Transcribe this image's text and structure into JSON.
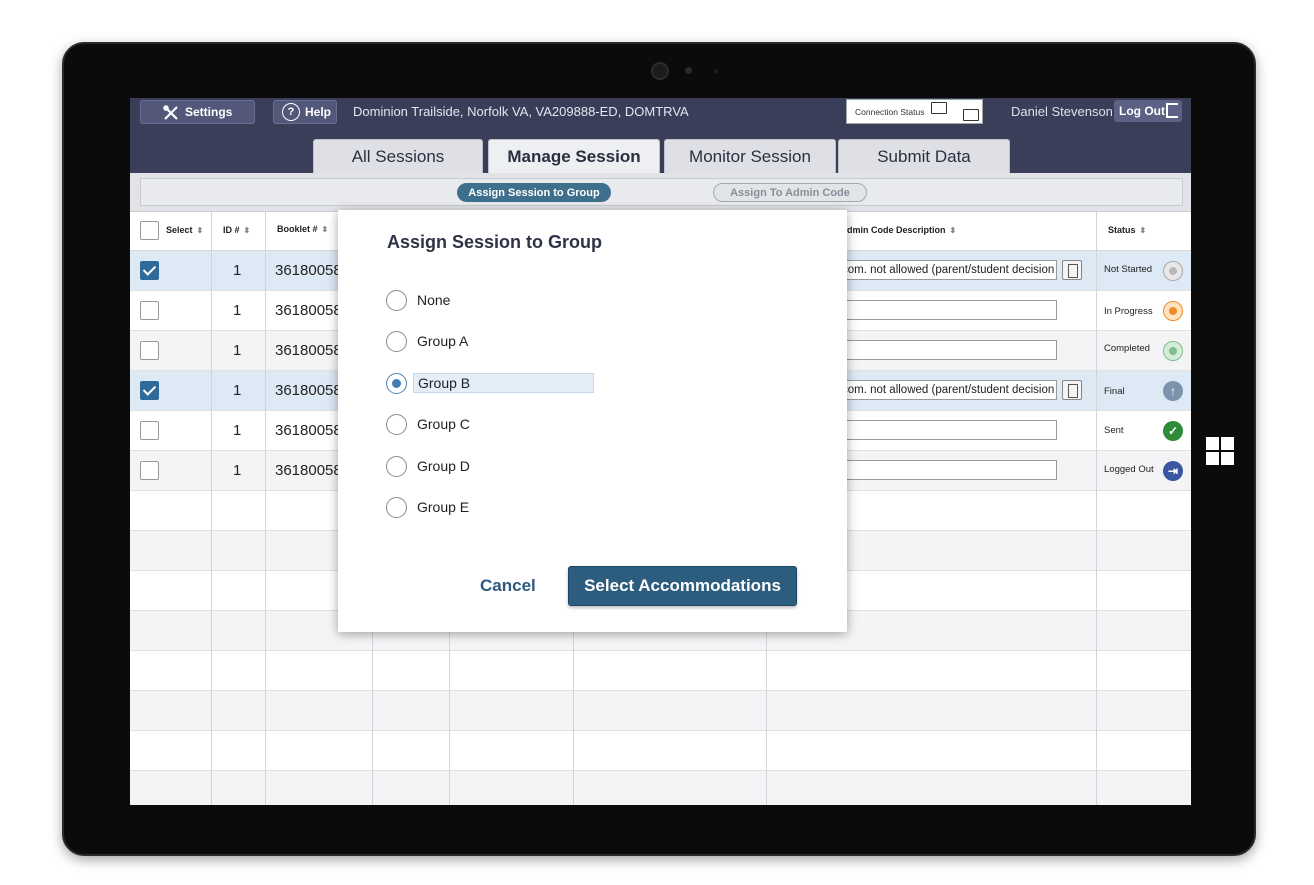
{
  "topbar": {
    "settings_label": "Settings",
    "help_label": "Help",
    "location": "Dominion Trailside, Norfolk VA, VA209888-ED, DOMTRVA",
    "connection_status": "Connection Status",
    "user_name": "Daniel Stevenson",
    "logout_label": "Log Out"
  },
  "tabs": [
    "All Sessions",
    "Manage Session",
    "Monitor Session",
    "Submit Data"
  ],
  "subbar": {
    "assign_group": "Assign Session to Group",
    "assign_admin": "Assign To Admin Code"
  },
  "table": {
    "headers": {
      "select": "Select",
      "id": "ID #",
      "booklet": "Booklet #",
      "admin_desc": "dmin Code Description",
      "status": "Status"
    },
    "rows": [
      {
        "id": "1",
        "booklet": "36180058",
        "desc": "com. not allowed (parent/student decision",
        "status": "Not Started",
        "checked": true
      },
      {
        "id": "1",
        "booklet": "36180058",
        "desc": "",
        "status": "In Progress",
        "checked": false
      },
      {
        "id": "1",
        "booklet": "36180058",
        "desc": "",
        "status": "Completed",
        "checked": false
      },
      {
        "id": "1",
        "booklet": "36180058",
        "desc": "com. not allowed (parent/student decision",
        "status": "Final",
        "checked": true
      },
      {
        "id": "1",
        "booklet": "36180058",
        "desc": "",
        "status": "Sent",
        "checked": false
      },
      {
        "id": "1",
        "booklet": "36180058",
        "desc": "",
        "status": "Logged Out",
        "checked": false
      }
    ]
  },
  "status_colors": {
    "not_started": "#b9b9b9",
    "in_progress": "#f08a24",
    "completed": "#7fbf8c",
    "final": "#7d93ad",
    "sent": "#2f8a3a",
    "logged_out": "#3a56a0"
  },
  "modal": {
    "title": "Assign Session to Group",
    "options": [
      "None",
      "Group A",
      "Group B",
      "Group C",
      "Group D",
      "Group E"
    ],
    "selected": "Group B",
    "cancel_label": "Cancel",
    "confirm_label": "Select Accommodations"
  }
}
